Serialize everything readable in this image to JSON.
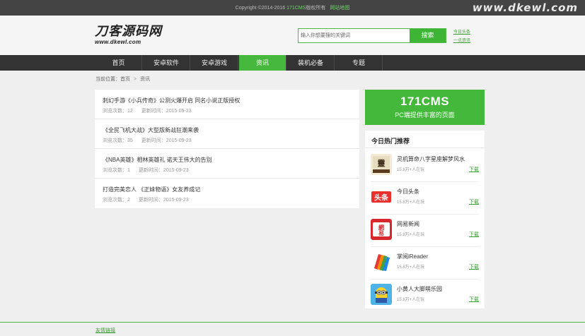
{
  "top": {
    "copyright": "Copyright ©2014-2016 ",
    "brand": "171CMS",
    "rights": "版权所有",
    "sitemap": "网站地图"
  },
  "watermark": "www.dkewl.com",
  "logo": {
    "cn": "刀客源码网",
    "en": "www.dkewl.com"
  },
  "search": {
    "placeholder": "输入你想要搜的关键词",
    "button": "搜索"
  },
  "header_links": [
    "今日头条",
    "一点资讯"
  ],
  "nav": [
    "首页",
    "安卓软件",
    "安卓游戏",
    "资讯",
    "装机必备",
    "专题"
  ],
  "breadcrumb": {
    "label": "当前位置：",
    "home": "首页",
    "current": "资讯"
  },
  "articles": [
    {
      "title": "刺幻手游《小兵传奇》公测火爆开启 同名小说正版授权",
      "views": "浏览次数：12",
      "time": "更新时间：2015-09-23"
    },
    {
      "title": "《全民飞机大战》大型版新战狂潮来袭",
      "views": "浏览次数：35",
      "time": "更新时间：2015-09-23"
    },
    {
      "title": "《NBA英雄》相林英雄礼 诺天王伟大的告别",
      "views": "浏览次数：1",
      "time": "更新时间：2015-09-23"
    },
    {
      "title": "打造完美恋人 《正妹物语》女友养成记",
      "views": "浏览次数：2",
      "time": "更新时间：2015-09-23"
    }
  ],
  "banner": {
    "big": "171CMS",
    "small": "PC端提供丰富的页面"
  },
  "hot": {
    "title": "今日热门推荐",
    "apps": [
      {
        "name": "灵机算命八字星座解梦风水",
        "sub": "15.8万+人在玩",
        "dl": "下载",
        "icon": "fortune-app-icon"
      },
      {
        "name": "今日头条",
        "sub": "15.8万+人在玩",
        "dl": "下载",
        "icon": "toutiao-app-icon"
      },
      {
        "name": "网易新闻",
        "sub": "15.8万+人在玩",
        "dl": "下载",
        "icon": "netease-news-app-icon"
      },
      {
        "name": "掌阅iReader",
        "sub": "15.8万+人在玩",
        "dl": "下载",
        "icon": "ireader-app-icon"
      },
      {
        "name": "小黄人大脚萌乐园",
        "sub": "15.8万+人在玩",
        "dl": "下载",
        "icon": "minion-app-icon"
      }
    ]
  },
  "footer": {
    "friend": "友情链接"
  },
  "colors": {
    "accent": "#46b83d",
    "topbar": "#444444",
    "nav": "#333333"
  }
}
